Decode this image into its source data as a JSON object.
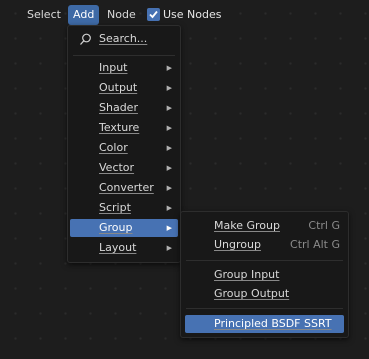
{
  "header": {
    "select_label": "Select",
    "add_label": "Add",
    "node_label": "Node",
    "use_nodes_label": "Use Nodes",
    "use_nodes_checked": true
  },
  "add_menu": {
    "search_label": "Search...",
    "items": [
      {
        "label": "Input",
        "has_submenu": true
      },
      {
        "label": "Output",
        "has_submenu": true
      },
      {
        "label": "Shader",
        "has_submenu": true
      },
      {
        "label": "Texture",
        "has_submenu": true
      },
      {
        "label": "Color",
        "has_submenu": true
      },
      {
        "label": "Vector",
        "has_submenu": true
      },
      {
        "label": "Converter",
        "has_submenu": true
      },
      {
        "label": "Script",
        "has_submenu": true
      },
      {
        "label": "Group",
        "has_submenu": true,
        "active": true
      },
      {
        "label": "Layout",
        "has_submenu": true
      }
    ]
  },
  "group_menu": {
    "make_group": {
      "label": "Make Group",
      "shortcut": "Ctrl G"
    },
    "ungroup": {
      "label": "Ungroup",
      "shortcut": "Ctrl Alt G"
    },
    "group_input": {
      "label": "Group Input"
    },
    "group_output": {
      "label": "Group Output"
    },
    "principled": {
      "label": "Principled BSDF SSRT",
      "active": true
    }
  },
  "colors": {
    "accent": "#4772b3",
    "menu_bg": "#181818",
    "canvas_bg": "#1d1d1d"
  }
}
